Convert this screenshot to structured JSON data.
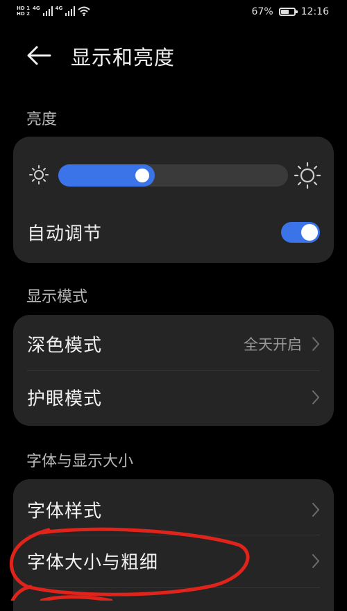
{
  "status_bar": {
    "sim1_label": "HD",
    "sim1_sub": "1",
    "sim2_label": "HD",
    "sim2_sub": "2",
    "network1": "4G",
    "network2": "4G",
    "battery_percent": "67%",
    "battery_level": 0.67,
    "time": "12:16"
  },
  "header": {
    "title": "显示和亮度"
  },
  "brightness": {
    "section_label": "亮度",
    "level": 0.42,
    "auto_label": "自动调节",
    "auto_enabled": true
  },
  "display_mode": {
    "section_label": "显示模式",
    "dark_mode_label": "深色模式",
    "dark_mode_value": "全天开启",
    "eye_comfort_label": "护眼模式"
  },
  "font_display": {
    "section_label": "字体与显示大小",
    "font_style_label": "字体样式",
    "font_size_label": "字体大小与粗细"
  },
  "colors": {
    "accent": "#3b73e8",
    "card": "#252525",
    "annotation": "#e0231b"
  }
}
